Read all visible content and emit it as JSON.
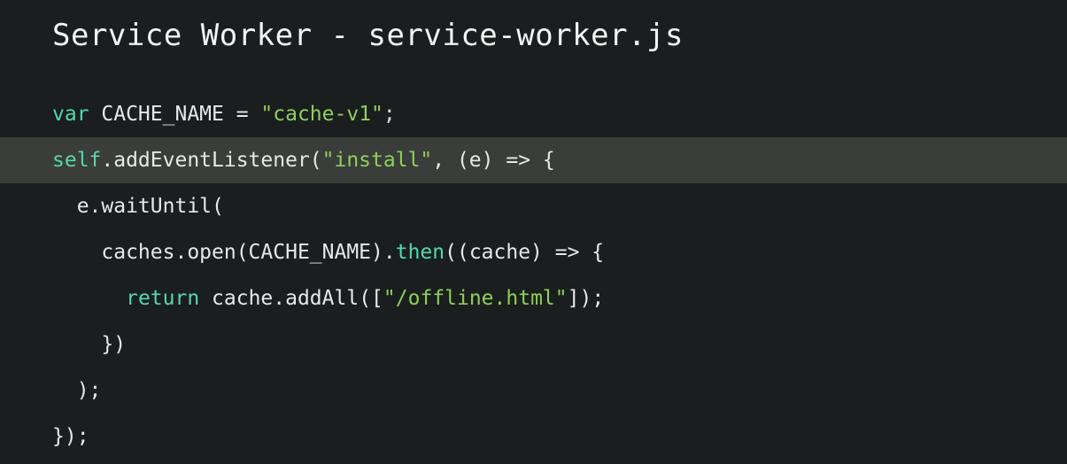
{
  "editor": {
    "title": "Service Worker - service-worker.js",
    "language": "javascript",
    "filename": "service-worker.js",
    "background_color": "#1a1e1e",
    "highlight_color": "#3a3d3a",
    "text_color": "#e6e9e8",
    "keyword_color": "#56d6b0",
    "string_color": "#8fcf5a",
    "highlighted_line_number": 2
  },
  "code_lines": [
    {
      "id": "line-1",
      "text": "var CACHE_NAME = \"cache-v1\";",
      "highlighted": false,
      "tokens": [
        {
          "t": "var",
          "c": "tok-keyword"
        },
        {
          "t": " CACHE_NAME = ",
          "c": "tok-plain"
        },
        {
          "t": "\"cache-v1\"",
          "c": "tok-string"
        },
        {
          "t": ";",
          "c": "tok-punct"
        }
      ]
    },
    {
      "id": "line-2",
      "text": "self.addEventListener(\"install\", (e) => {",
      "highlighted": true,
      "tokens": [
        {
          "t": "self",
          "c": "tok-keyword"
        },
        {
          "t": ".addEventListener(",
          "c": "tok-plain"
        },
        {
          "t": "\"install\"",
          "c": "tok-string"
        },
        {
          "t": ", (e) => {",
          "c": "tok-plain"
        }
      ]
    },
    {
      "id": "line-3",
      "text": "  e.waitUntil(",
      "highlighted": false,
      "tokens": [
        {
          "t": "  e.waitUntil(",
          "c": "tok-plain"
        }
      ]
    },
    {
      "id": "line-4",
      "text": "    caches.open(CACHE_NAME).then((cache) => {",
      "highlighted": false,
      "tokens": [
        {
          "t": "    caches.open(CACHE_NAME).",
          "c": "tok-plain"
        },
        {
          "t": "then",
          "c": "tok-method"
        },
        {
          "t": "((cache) => {",
          "c": "tok-plain"
        }
      ]
    },
    {
      "id": "line-5",
      "text": "      return cache.addAll([\"/offline.html\"]);",
      "highlighted": false,
      "tokens": [
        {
          "t": "      ",
          "c": "tok-plain"
        },
        {
          "t": "return",
          "c": "tok-keyword"
        },
        {
          "t": " cache.addAll([",
          "c": "tok-plain"
        },
        {
          "t": "\"/offline.html\"",
          "c": "tok-string"
        },
        {
          "t": "]);",
          "c": "tok-plain"
        }
      ]
    },
    {
      "id": "line-6",
      "text": "    })",
      "highlighted": false,
      "tokens": [
        {
          "t": "    })",
          "c": "tok-plain"
        }
      ]
    },
    {
      "id": "line-7",
      "text": "  );",
      "highlighted": false,
      "tokens": [
        {
          "t": "  );",
          "c": "tok-plain"
        }
      ]
    },
    {
      "id": "line-8",
      "text": "});",
      "highlighted": false,
      "tokens": [
        {
          "t": "});",
          "c": "tok-plain"
        }
      ]
    }
  ]
}
